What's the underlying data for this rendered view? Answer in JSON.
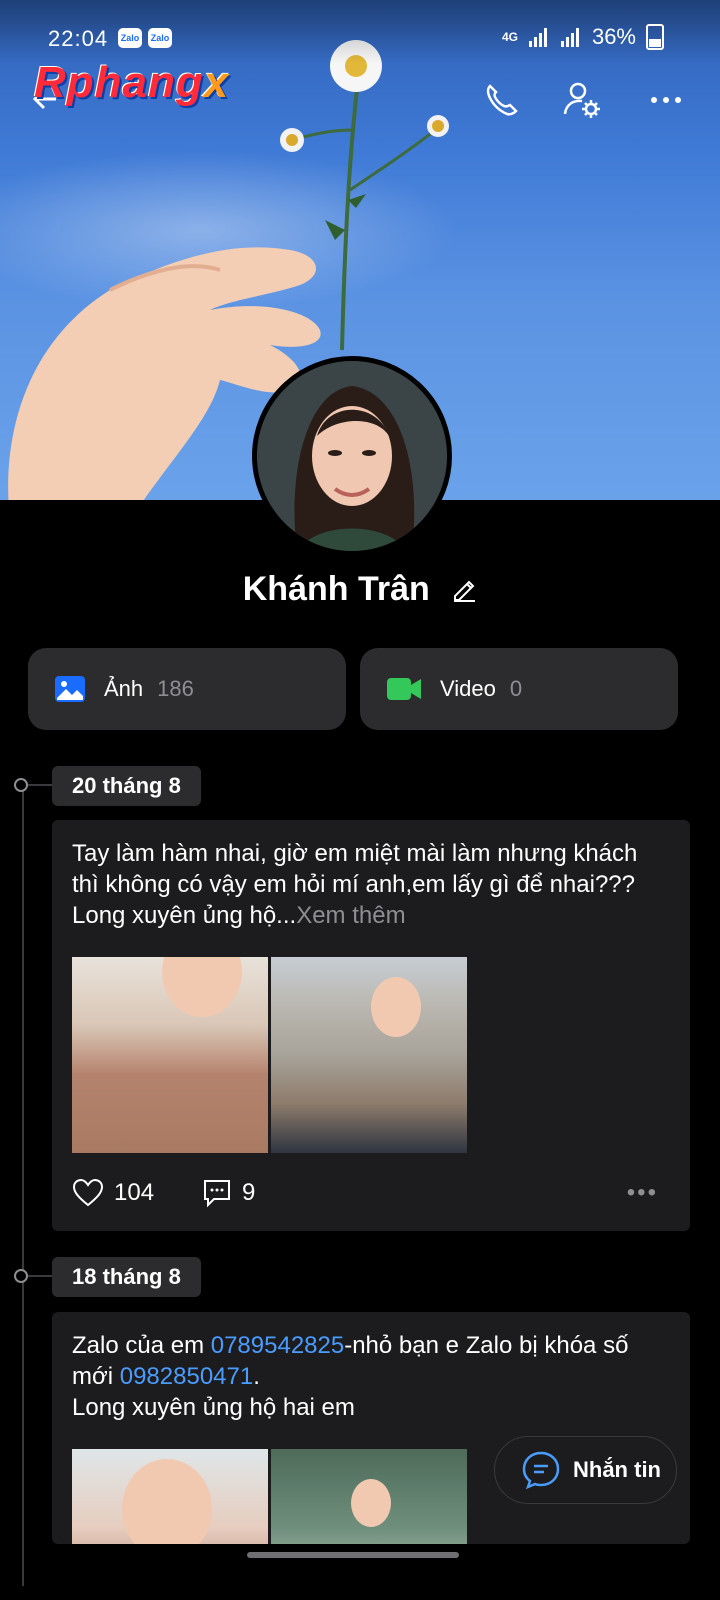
{
  "status_bar": {
    "time": "22:04",
    "network": "4G",
    "battery": "36%",
    "notif_badges": [
      "Zalo",
      "Zalo"
    ]
  },
  "header": {
    "watermark": {
      "main": "Rphang",
      "accent": "x"
    }
  },
  "profile": {
    "name": "Khánh Trân"
  },
  "media": {
    "photos": {
      "label": "Ảnh",
      "count": "186"
    },
    "videos": {
      "label": "Video",
      "count": "0"
    }
  },
  "posts": [
    {
      "date": "20 tháng 8",
      "text": "Tay làm hàm nhai, giờ em miệt mài làm nhưng khách thì không có vậy em hỏi mí anh,em lấy gì để nhai??? Long xuyên ủng hộ...",
      "see_more": "Xem thêm",
      "likes": "104",
      "comments": "9"
    },
    {
      "date": "18 tháng 8",
      "text_1": "Zalo của em ",
      "phone_1": "0789542825",
      "text_2": "-nhỏ bạn e Zalo bị khóa số mới ",
      "phone_2": "0982850471",
      "text_3": ".",
      "text_4": "Long xuyên ủng hộ hai em"
    }
  ],
  "message_button": {
    "label": "Nhắn tin"
  },
  "colors": {
    "background": "#000000",
    "card": "#2c2c2e",
    "post": "#1c1c1e",
    "link": "#4a9cff",
    "photo_icon": "#1a6cff",
    "video_icon": "#34c759"
  }
}
